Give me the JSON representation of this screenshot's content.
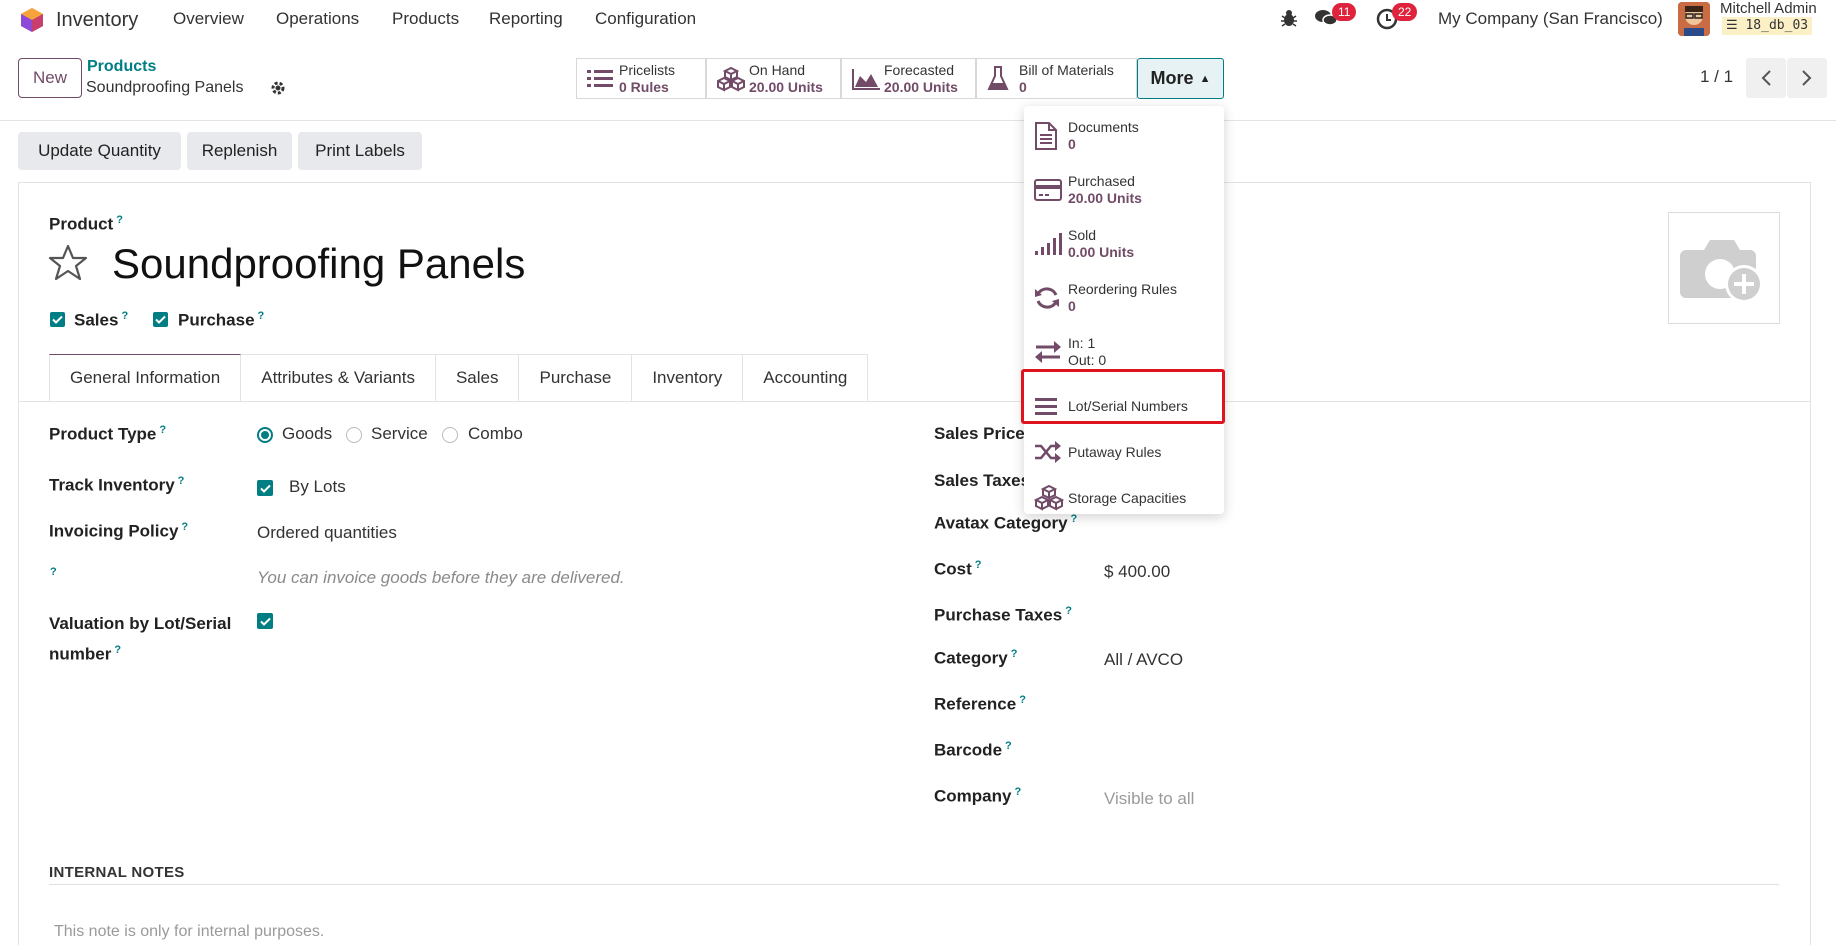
{
  "navbar": {
    "app_name": "Inventory",
    "menu": [
      "Overview",
      "Operations",
      "Products",
      "Reporting",
      "Configuration"
    ],
    "messages_count": "11",
    "activities_count": "22",
    "company": "My Company (San Francisco)",
    "user_name": "Mitchell Admin",
    "db_name": "18_db_03"
  },
  "control_panel": {
    "new_label": "New",
    "breadcrumb_parent": "Products",
    "breadcrumb_current": "Soundproofing Panels",
    "smart_buttons": [
      {
        "label": "Pricelists",
        "value": "0 Rules",
        "icon": "list-icon"
      },
      {
        "label": "On Hand",
        "value": "20.00 Units",
        "icon": "cubes-icon"
      },
      {
        "label": "Forecasted",
        "value": "20.00 Units",
        "icon": "area-chart-icon"
      },
      {
        "label": "Bill of Materials",
        "value": "0",
        "icon": "flask-icon"
      }
    ],
    "more_label": "More",
    "pager": "1 / 1"
  },
  "actions": [
    "Update Quantity",
    "Replenish",
    "Print Labels"
  ],
  "form": {
    "product_label": "Product",
    "product_name": "Soundproofing Panels",
    "sales_label": "Sales",
    "purchase_label": "Purchase",
    "tabs": [
      "General Information",
      "Attributes & Variants",
      "Sales",
      "Purchase",
      "Inventory",
      "Accounting"
    ],
    "product_type_label": "Product Type",
    "product_type_options": [
      "Goods",
      "Service",
      "Combo"
    ],
    "product_type_selected": "Goods",
    "track_inventory_label": "Track Inventory",
    "track_inventory_value": "By Lots",
    "invoicing_policy_label": "Invoicing Policy",
    "invoicing_policy_value": "Ordered quantities",
    "invoicing_hint": "You can invoice goods before they are delivered.",
    "valuation_label_line1": "Valuation by Lot/Serial",
    "valuation_label_line2": "number",
    "sales_price_label": "Sales Price",
    "sales_taxes_label": "Sales Taxes",
    "avatax_label": "Avatax Category",
    "cost_label": "Cost",
    "cost_value": "$ 400.00",
    "purchase_taxes_label": "Purchase Taxes",
    "category_label": "Category",
    "category_value": "All / AVCO",
    "reference_label": "Reference",
    "barcode_label": "Barcode",
    "company_label": "Company",
    "company_placeholder": "Visible to all",
    "notes_title": "INTERNAL NOTES",
    "notes_placeholder": "This note is only for internal purposes."
  },
  "dropdown": {
    "items": [
      {
        "label": "Documents",
        "value": "0",
        "icon": "document-icon"
      },
      {
        "label": "Purchased",
        "value": "20.00 Units",
        "icon": "credit-card-icon"
      },
      {
        "label": "Sold",
        "value": "0.00 Units",
        "icon": "signal-icon"
      },
      {
        "label": "Reordering Rules",
        "value": "0",
        "icon": "refresh-icon"
      },
      {
        "label": "In: 1",
        "value": "Out: 0",
        "icon": "exchange-icon"
      },
      {
        "label": "Lot/Serial Numbers",
        "value": "",
        "icon": "bars-icon"
      },
      {
        "label": "Putaway Rules",
        "value": "",
        "icon": "random-icon"
      },
      {
        "label": "Storage Capacities",
        "value": "",
        "icon": "cubes-icon"
      }
    ]
  },
  "colors": {
    "brand": "#714b67",
    "accent": "#017e84",
    "badge": "#e0233d",
    "highlight": "#e0141e"
  }
}
